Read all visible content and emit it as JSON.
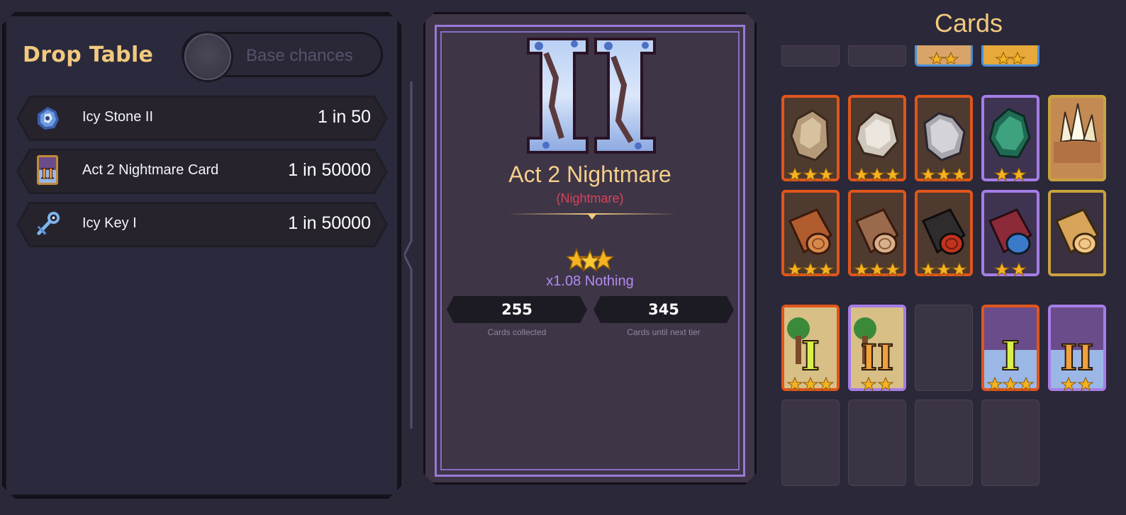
{
  "drop_table": {
    "title": "Drop Table",
    "toggle_label": "Base chances",
    "items": [
      {
        "name": "Icy Stone II",
        "chance": "1 in 50",
        "icon": "icy-stone-icon"
      },
      {
        "name": "Act 2 Nightmare Card",
        "chance": "1 in 50000",
        "icon": "nightmare-card-icon"
      },
      {
        "name": "Icy Key I",
        "chance": "1 in 50000",
        "icon": "icy-key-icon"
      }
    ]
  },
  "card_detail": {
    "title": "Act 2 Nightmare",
    "subtitle": "(Nightmare)",
    "multiplier": "x1.08 Nothing",
    "stars": 3,
    "collected_value": "255",
    "collected_label": "Cards collected",
    "next_tier_value": "345",
    "next_tier_label": "Cards until next tier"
  },
  "cards_panel": {
    "title": "Cards"
  },
  "colors": {
    "gold": "#f2c97f",
    "rare_orange": "#e0561c",
    "epic_purple": "#a57de6",
    "legendary_gold": "#c9a23f",
    "nightmare_red": "#d8435a",
    "blue": "#4a8fd8"
  }
}
